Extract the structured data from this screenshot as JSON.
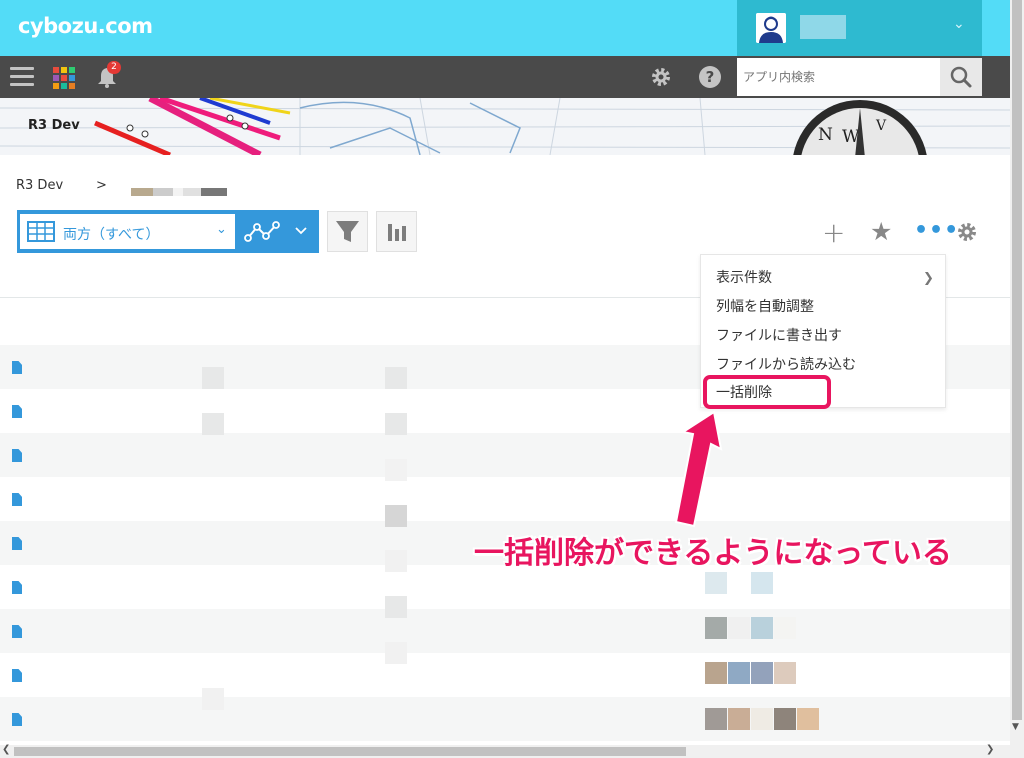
{
  "header": {
    "logo": "cybozu.com",
    "notification_count": "2",
    "search_placeholder": "アプリ内検索"
  },
  "banner": {
    "app_title": "R3 Dev"
  },
  "breadcrumb": {
    "root": "R3 Dev",
    "separator": ">"
  },
  "view": {
    "label": "両方（すべて）"
  },
  "menu": {
    "items": [
      "表示件数",
      "列幅を自動調整",
      "ファイルに書き出す",
      "ファイルから読み込む",
      "一括削除"
    ]
  },
  "annotation": {
    "text": "一括削除ができるようになっている"
  },
  "colors": {
    "accent": "#3498db",
    "highlight": "#e8155f",
    "header": "#53dcf7"
  },
  "icons": [
    "hamburger-icon",
    "apps-grid-icon",
    "bell-icon",
    "gear-icon",
    "help-icon",
    "search-icon",
    "table-view-icon",
    "graph-icon",
    "filter-icon",
    "bar-chart-icon",
    "plus-icon",
    "star-icon",
    "more-icon",
    "document-icon"
  ]
}
